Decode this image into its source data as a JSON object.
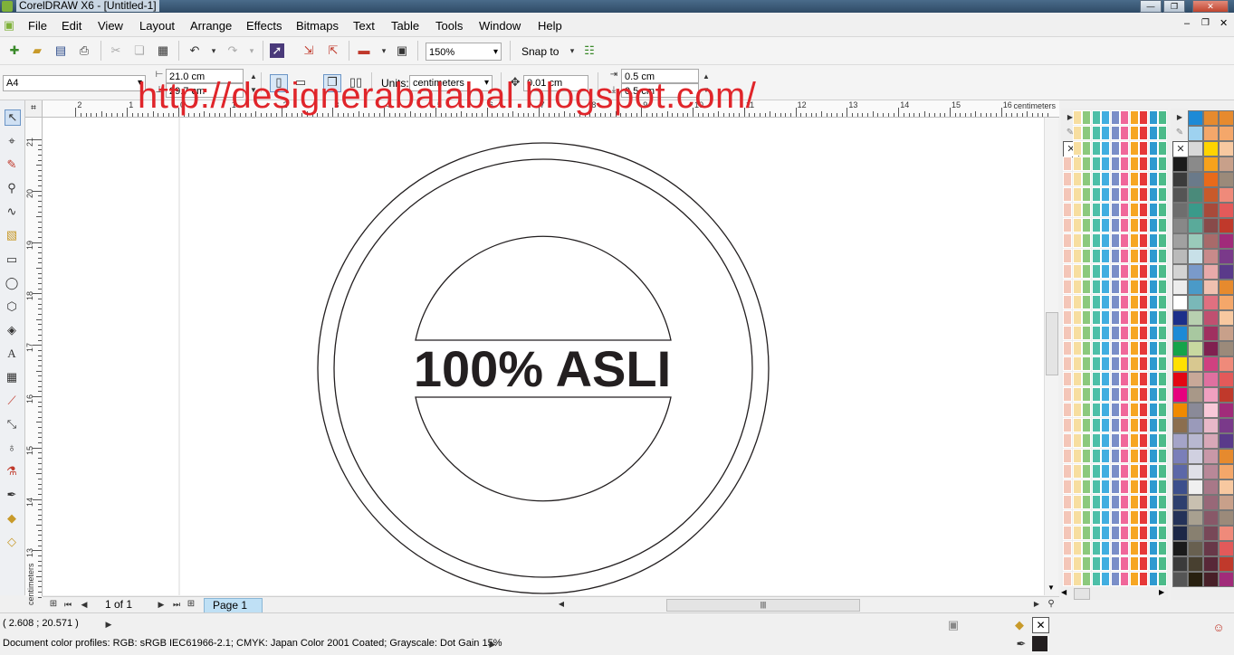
{
  "window": {
    "title": "CorelDRAW X6 - [Untitled-1]"
  },
  "menu": {
    "items": [
      {
        "label": "File"
      },
      {
        "label": "Edit"
      },
      {
        "label": "View"
      },
      {
        "label": "Layout"
      },
      {
        "label": "Arrange"
      },
      {
        "label": "Effects"
      },
      {
        "label": "Bitmaps"
      },
      {
        "label": "Text"
      },
      {
        "label": "Table"
      },
      {
        "label": "Tools"
      },
      {
        "label": "Window"
      },
      {
        "label": "Help"
      }
    ]
  },
  "toolbar": {
    "zoom_value": "150%",
    "snap_to_label": "Snap to"
  },
  "property_bar": {
    "page_size": "A4",
    "width": "21.0 cm",
    "height": "29.7 cm",
    "units_label": "Units:",
    "units_value": "centimeters",
    "nudge": "0.01 cm",
    "dup_x": "0.5 cm",
    "dup_y": "0.5 cm"
  },
  "ruler": {
    "unit_label": "centimeters",
    "h_numbers": [
      "2",
      "1",
      "0",
      "1",
      "2",
      "3",
      "4",
      "5",
      "6",
      "7",
      "8",
      "9",
      "10",
      "11",
      "12",
      "13",
      "14",
      "15",
      "16"
    ],
    "v_numbers": [
      "21",
      "20",
      "19",
      "18",
      "17",
      "16",
      "15",
      "14",
      "13"
    ],
    "v_unit_label": "centimeters"
  },
  "canvas": {
    "stamp_text": "100% ASLI",
    "watermark": "http://designerabalabal.blogspot.com/"
  },
  "page_nav": {
    "counter": "1 of 1",
    "tab_label": "Page 1"
  },
  "status": {
    "coordinates": "( 2.608 ; 20.571 )",
    "color_profiles": "Document color profiles: RGB: sRGB IEC61966-2.1; CMYK: Japan Color 2001 Coated; Grayscale: Dot Gain 15%"
  },
  "colors": {
    "accent": "#e0252a",
    "stroke": "#231f20",
    "page_tab": "#bfe0f5"
  },
  "palette1_columns": [
    "#f4c6b8",
    "#f7dea0",
    "#8cc97d",
    "#4dbfa8",
    "#41aee0",
    "#7a8ec8",
    "#f0679a",
    "#f6a623",
    "#e63838",
    "#2e9ad0",
    "#4cbb8a"
  ],
  "palette2_colors": [
    "#1b1b1b",
    "#3b3b3b",
    "#555555",
    "#6e6e6e",
    "#888888",
    "#a1a1a1",
    "#bababa",
    "#d3d3d3",
    "#ececec",
    "#ffffff",
    "#1c2f8a",
    "#1d8ad6",
    "#15a34a",
    "#ffe000",
    "#e30613",
    "#e6007e",
    "#f08a00",
    "#8b6e4e",
    "#a4a4c8",
    "#7a7fb9",
    "#5c68a8",
    "#3c4f8c",
    "#2d3f6e",
    "#243259",
    "#1c2747"
  ]
}
